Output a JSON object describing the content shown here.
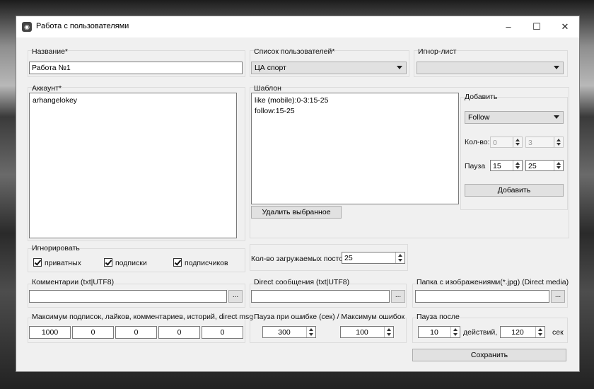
{
  "window": {
    "title": "Работа с пользователями",
    "minimize": "–",
    "maximize": "☐",
    "close": "✕"
  },
  "name_group": {
    "label": "Название*",
    "value": "Работа №1"
  },
  "users_list": {
    "label": "Список пользователей*",
    "selected": "ЦА спорт"
  },
  "ignore_list": {
    "label": "Игнор-лист",
    "selected": ""
  },
  "account": {
    "label": "Аккаунт*",
    "lines": [
      "arhangelokey"
    ]
  },
  "template": {
    "label": "Шаблон",
    "lines": [
      "like (mobile):0-3:15-25",
      "follow:15-25"
    ],
    "delete_button": "Удалить выбранное"
  },
  "add_group": {
    "label": "Добавить",
    "action_selected": "Follow",
    "count_label": "Кол-во:",
    "count_from": "0",
    "count_to": "3",
    "pause_label": "Пауза",
    "pause_from": "15",
    "pause_to": "25",
    "add_button": "Добавить"
  },
  "ignore_group": {
    "label": "Игнорировать",
    "private": "приватных",
    "subscriptions": "подписки",
    "followers": "подписчиков"
  },
  "posts_count": {
    "label": "Кол-во загружаемых постов:",
    "value": "25"
  },
  "comments": {
    "label": "Комментарии (txt|UTF8)",
    "value": "",
    "browse": "..."
  },
  "direct": {
    "label": "Direct сообщения (txt|UTF8)",
    "value": "",
    "browse": "..."
  },
  "images": {
    "label": "Папка с изображениями(*.jpg) (Direct media)",
    "value": "",
    "browse": "..."
  },
  "limits": {
    "label": "Максимум подписок, лайков, комментариев, историй, direct msg",
    "values": [
      "1000",
      "0",
      "0",
      "0",
      "0"
    ]
  },
  "error_pause": {
    "label": "Пауза при ошибке (сек) / Максимум ошибок",
    "pause": "300",
    "max_errors": "100"
  },
  "pause_after": {
    "label": "Пауза после",
    "actions": "10",
    "actions_label": "действий,",
    "seconds": "120",
    "seconds_label": "сек"
  },
  "save_button": "Сохранить"
}
